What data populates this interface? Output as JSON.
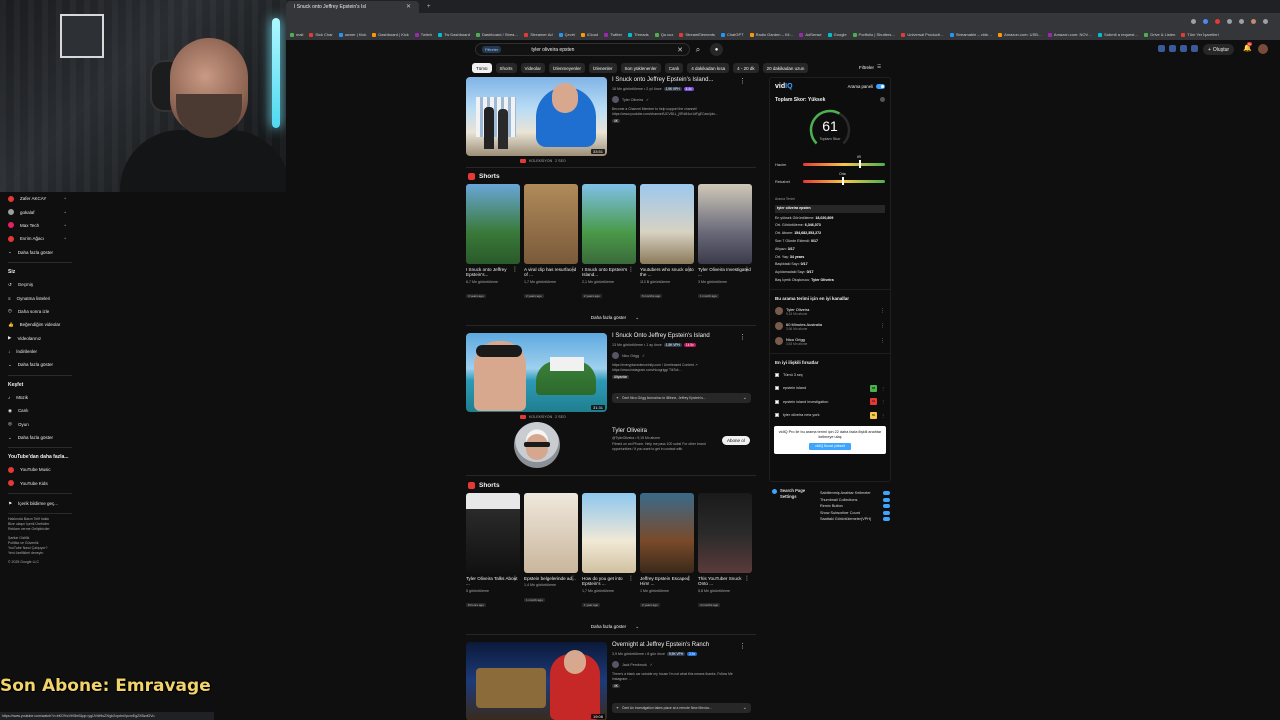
{
  "browser": {
    "tab_title": "I Snuck onto Jeffrey Epstein's Isl",
    "bookmarks": [
      "mail",
      "Sick Char",
      "owner | Kick",
      "Dashboard | Kick",
      "Twitch",
      "Tw Dashboard",
      "Dashboard / Strea…",
      "Streamer Ad",
      "Çeviri",
      "iCloud",
      "Twitter",
      "Threads",
      "Qu.vux",
      "StreamElements",
      "ChatGPT",
      "Radio Garden – Kli…",
      "AdSense",
      "Google",
      "Portfolio | Shutters…",
      "Universal Producti…",
      "Streamable – vide…",
      "Amazon.com: USB…",
      "Amazon.com: NOV…",
      "Submit a request…",
      "Drive & Listen",
      "Tüm Yer İşaretleri"
    ]
  },
  "header": {
    "search_filter_chip": "Filtreler",
    "search_query": "tyler oliveira epsten",
    "create_label": "Oluştur",
    "notifications_count": "9+"
  },
  "chips": [
    "Tümü",
    "Shorts",
    "Videolar",
    "İzlenmeyenler",
    "İzlenenler",
    "Son yüklenenler",
    "Canlı",
    "4 dakikadan kısa",
    "4 - 20 dk",
    "20 dakikadan uzun"
  ],
  "filters_label": "Filtreler",
  "sidebar": {
    "subs": [
      "Zafer AKCAY",
      "gokalaf",
      "Max Tech",
      "Evrim Ağacı"
    ],
    "subs_more": "Daha fazla göster",
    "you_title": "Siz",
    "you_items": [
      "Geçmiş",
      "Oynatma listeleri",
      "Daha sonra izle",
      "Beğendiğim videolar",
      "Videolarınız",
      "İndirilenler",
      "Daha fazla göster"
    ],
    "explore_title": "Keşfet",
    "explore_items": [
      "Müzik",
      "Canlı",
      "Oyun",
      "Daha fazla göster"
    ],
    "more_title": "YouTube'dan daha fazla...",
    "more_items": [
      "YouTube Music",
      "YouTube Kids"
    ],
    "feedback": "İçerik bildirme geç...",
    "footer1": "Hakkında  Basın  Telif hakkı",
    "footer2": "Bize ulaşın  İçerik Üreticiler",
    "footer3": "Reklam verme  Geliştiriciler",
    "footer4": "Şartlar  Gizlilik",
    "footer5": "Politika ve Güvenlik",
    "footer6": "YouTube Nasıl Çalışıyor?",
    "footer7": "Yeni özellikleri deneyin",
    "copyright": "© 2025 Google LLC"
  },
  "overlay": {
    "last_sub": "Son Abone: Emravage",
    "status_url": "https://www.youtube.com/watch?v=bKO%cVtV8e0&pp=ygUVdHlsZXIgb2xpdmVpcmEgZXBzdGVu"
  },
  "video1": {
    "title": "I Snuck onto Jeffrey Epstein's Island...",
    "views": "16 Mn görüntüleme • 2 yıl önce",
    "vph": "1,9K VPH",
    "score": "4.4x",
    "channel": "Tyler Oliveira",
    "desc": "Become a Channel Member to help support the channel! https://www.youtube.com/channel/UCVB1L_j9Rz84ur1dFgECaw/join...",
    "badge": "4K",
    "duration": "33:51",
    "under_label": "KOLEKSİYON",
    "under_score": "2 SEO"
  },
  "shorts1": {
    "title": "Shorts",
    "items": [
      {
        "title": "I Snuck onto Jeffrey Epstein's...",
        "views": "6,7 Mn görüntüleme",
        "age": "3 years ago"
      },
      {
        "title": "A viral clip has resurfaced of ...",
        "views": "1,7 Mn görüntüleme",
        "age": "2 years ago"
      },
      {
        "title": "I Snuck onto Epstein's Island...",
        "views": "2,1 Mn görüntüleme",
        "age": "2 years ago"
      },
      {
        "title": "Youtubers who snuck onto the ...",
        "views": "113 B görüntüleme",
        "age": "6 months ago"
      },
      {
        "title": "Tyler Oliveira Investigated ...",
        "views": "3 Mn görüntüleme",
        "age": "1 month ago"
      }
    ],
    "more": "Daha fazla göster"
  },
  "video2": {
    "title": "I Snuck Onto Jeffrey Epstein's Island",
    "views": "13 Mn görüntüleme • 1 ay önce",
    "vph": "1,9K VPH",
    "score": "14.5x",
    "channel": "Nico Grigg",
    "desc": "https://everyplacedenceinity.com / Unreleased Content ↗ https://www.instagram.com/nicogrigg/ TikTok...",
    "badge": "Altyazılar",
    "duration": "31:31",
    "ai_summary": "Özet  Nico Grigg ilonnaimo to illlllnne, Jeffrey Epstein's...",
    "under_label": "KOLEKSİYON",
    "under_score": "2 SEO"
  },
  "channel_card": {
    "name": "Tyler Oliveira",
    "handle": "@TylerOliveira • 9,15 Mn abone",
    "desc": "Filmed on an iPhone. Help me pass 100 subs! For other brand opportunities / if you want to get in contact with",
    "subscribe": "Abone ol"
  },
  "shorts2": {
    "title": "Shorts",
    "items": [
      {
        "title": "Tyler Oliveira Talks About ...",
        "views": "5 görüntüleme",
        "age": "8 hours ago"
      },
      {
        "title": "Epstein belgelerinde ad...",
        "views": "1,4 Mn görüntüleme",
        "age": "1 month ago"
      },
      {
        "title": "How do you get into Epstein's ...",
        "views": "1,7 Mn görüntüleme",
        "age": "1 year ago"
      },
      {
        "title": "Jeffrey Epstein Escaped Him! ...",
        "views": "1 Mn görüntüleme",
        "age": "2 years ago"
      },
      {
        "title": "This YouTuber Snuck Onto ...",
        "views": "5,8 Mn görüntüleme",
        "age": "4 months ago"
      }
    ],
    "more": "Daha fazla göster"
  },
  "video3": {
    "title": "Overnight at Jeffrey Epstein's Ranch",
    "views": "3,9 Mn görüntüleme • 8 gün önce",
    "vph": "9,9K VPH",
    "score": "3,9x",
    "channel": "Jack Pembrook",
    "desc": "There's a black car outside my house I'm not what this means thanks. Follow Me Instagram: ...",
    "badge": "4K",
    "duration": "19:08",
    "ai_summary": "Özet  An investigation takes place at a remote New Mexico..."
  },
  "vidiq": {
    "logo_pre": "vid",
    "logo_post": "IQ",
    "toggle_label": "Arama paneli",
    "score_title": "Toplam Skor: Yüksek",
    "score_value": "61",
    "score_label": "Toplam Skor",
    "volume_label": "Hacim",
    "volume_value": "69",
    "competition_label": "Rekabet",
    "competition_value": "Orta",
    "term_label": "Arama Terimi",
    "term": "tyler oliveira epsten",
    "stats": [
      {
        "k": "En yüksek Görüntüleme:",
        "v": "18,020,809"
      },
      {
        "k": "Ort. Görüntüleme:",
        "v": "6,346,073"
      },
      {
        "k": "Ort. Abone:",
        "v": "154,682,353,272"
      },
      {
        "k": "Son 7 Günde Eklendi:",
        "v": "0/17"
      },
      {
        "k": "Altyazı:",
        "v": "3/17"
      },
      {
        "k": "Ort. Yaş:",
        "v": "34 years"
      },
      {
        "k": "Başlıktaki Sayı:",
        "v": "0/17"
      },
      {
        "k": "Açıklamadaki Sayı:",
        "v": "0/17"
      },
      {
        "k": "Baş İçerik Oluşturucu:",
        "v": "Tyler Oliveira"
      }
    ],
    "channels_title": "Bu arama terimi için en iyi kanallar",
    "channels": [
      {
        "name": "Tyler Oliveira",
        "subs": "9,15 Mn abone"
      },
      {
        "name": "60 Minutes Australia",
        "subs": "3,96 Mn abone"
      },
      {
        "name": "Nico Grigg",
        "subs": "3,53 Mn abone"
      }
    ],
    "kw_title": "En iyi ilişkili fırsatlar",
    "kw_select_all": "Tümü 3 seç",
    "keywords": [
      {
        "term": "epstein island",
        "score": "68",
        "color": "#4caf50"
      },
      {
        "term": "epstein island investigation",
        "score": "41",
        "color": "#e53935"
      },
      {
        "term": "tyler oliveira new york",
        "score": "50",
        "color": "#f7c948"
      }
    ],
    "promo_text": "vidIQ Pro ile bu arama terimi için 22 daha fazla ilişkili anahtar kelimeye ulaş",
    "promo_button": "vidIQ Boost yükselt"
  },
  "search_page_settings": {
    "title": "Search Page Settings",
    "options": [
      "Sabitlenmiş Anahtar Kelimeler",
      "Thumbnail Collections",
      "Remix Button",
      "Show Subscriber Count",
      "Saattaki Görüntülemeler(VPH)"
    ]
  }
}
